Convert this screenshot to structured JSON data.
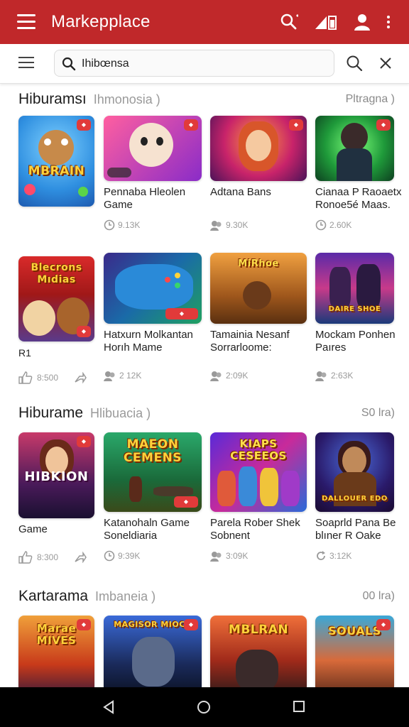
{
  "appbar": {
    "title": "Markepplace"
  },
  "search": {
    "query": "Ihibœnsa"
  },
  "sections": [
    {
      "title": "Hiburamsı",
      "subtitle": "Ihmonosia )",
      "more": "Pltragna )"
    },
    {
      "title": "Hiburame",
      "subtitle": "Hlibuacia )",
      "more": "S0 lra)"
    },
    {
      "title": "Kartarama",
      "subtitle": "Imbaneia )",
      "more": "00 lra)"
    }
  ],
  "rows": [
    [
      {
        "name": [
          "",
          ""
        ],
        "meta": ""
      },
      {
        "name": [
          "Pennaba Hleolen",
          "Game"
        ],
        "meta": "9.13K"
      },
      {
        "name": [
          "Adtana Bans",
          ""
        ],
        "meta": "9.30K"
      },
      {
        "name": [
          "Cianaa P Raoaetx",
          "Ronoe5é Maas."
        ],
        "meta": "2.60K"
      }
    ],
    [
      {
        "name": [
          "R1",
          ""
        ],
        "meta": "8:500"
      },
      {
        "name": [
          "Hatxurn Molkantan",
          "Horıh Mame"
        ],
        "meta": "2 12K"
      },
      {
        "name": [
          "Tamainia Nesanf",
          "Sorrarloome:"
        ],
        "meta": "2:09K"
      },
      {
        "name": [
          "Mockam Ponhen",
          "Paıres"
        ],
        "meta": "2:63K"
      }
    ],
    [
      {
        "name": [
          "Game",
          ""
        ],
        "meta": "8:300"
      },
      {
        "name": [
          "Katanohaln Game",
          "Soneldiaria"
        ],
        "meta": "9:39K"
      },
      {
        "name": [
          "Parela Rober Shek",
          "Sobnent"
        ],
        "meta": "3:09K"
      },
      {
        "name": [
          "Soaprld Pana Be",
          "blıner R Oake"
        ],
        "meta": "3:12K"
      }
    ]
  ],
  "art": {
    "row1": [
      "MBRAIN",
      "",
      "",
      ""
    ],
    "row2": [
      "Blecrons Mıdias",
      "",
      "",
      "DAIRE SHOE"
    ],
    "row3": [
      "HIBKION",
      "MAEON CEMENS",
      "KIAPS CESEEOS",
      "DALLOUER EDO"
    ],
    "row4": [
      "Marae MIVES",
      "MAGISOR MIOCR",
      "MBLRAN",
      "SOUALS"
    ]
  },
  "colors": {
    "brand": "#c0282a",
    "navbar": "#000000"
  },
  "icons": [
    "menu-icon",
    "search-icon",
    "signal-icon",
    "account-icon",
    "more-vert-icon",
    "close-icon",
    "back-nav-icon",
    "home-nav-icon",
    "recents-nav-icon"
  ]
}
